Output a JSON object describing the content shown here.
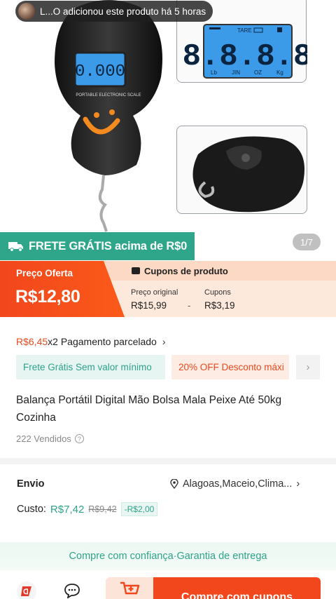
{
  "notice": {
    "text": "L...O adicionou este produto há 5 horas"
  },
  "gallery": {
    "counter": "1/7",
    "display_digits": "8.8.8.8",
    "main_display": "0.000",
    "display_labels": [
      "Lb",
      "JIN",
      "OZ",
      "Kg"
    ],
    "tare": "TARE",
    "scale_label": "PORTABLE ELECTRONIC SCALE"
  },
  "free_shipping": {
    "text": "FRETE GRÁTIS acima de R$0"
  },
  "price": {
    "offer_label": "Preço Oferta",
    "offer_value": "R$12,80",
    "coupons_header": "Cupons de produto",
    "original_label": "Preço original",
    "original_value": "R$15,99",
    "minus": "-",
    "coupon_label": "Cupons",
    "coupon_value": "R$3,19"
  },
  "installment": {
    "amount": "R$6,45",
    "text": " x2 Pagamento parcelado"
  },
  "tags": [
    {
      "text": "Frete Grátis Sem valor mínimo"
    },
    {
      "text": "20% OFF Desconto máxi"
    }
  ],
  "product": {
    "title": "Balança Portátil Digital Mão Bolsa Mala Peixe Até 50kg Cozinha",
    "sold": "222 Vendidos"
  },
  "shipping": {
    "label": "Envio",
    "location": "Alagoas,Maceio,Clima...",
    "cost_label": "Custo:",
    "cost_new": "R$7,42",
    "cost_old": "R$9,42",
    "cost_discount": "-R$2,00"
  },
  "guarantee": {
    "text": "Compre com confiança·Garantia de entrega"
  },
  "bottom": {
    "buy_label": "Compre com cupons"
  },
  "colors": {
    "accent": "#f2461c",
    "green": "#2fa58a",
    "lcd": "#3b9be8"
  }
}
